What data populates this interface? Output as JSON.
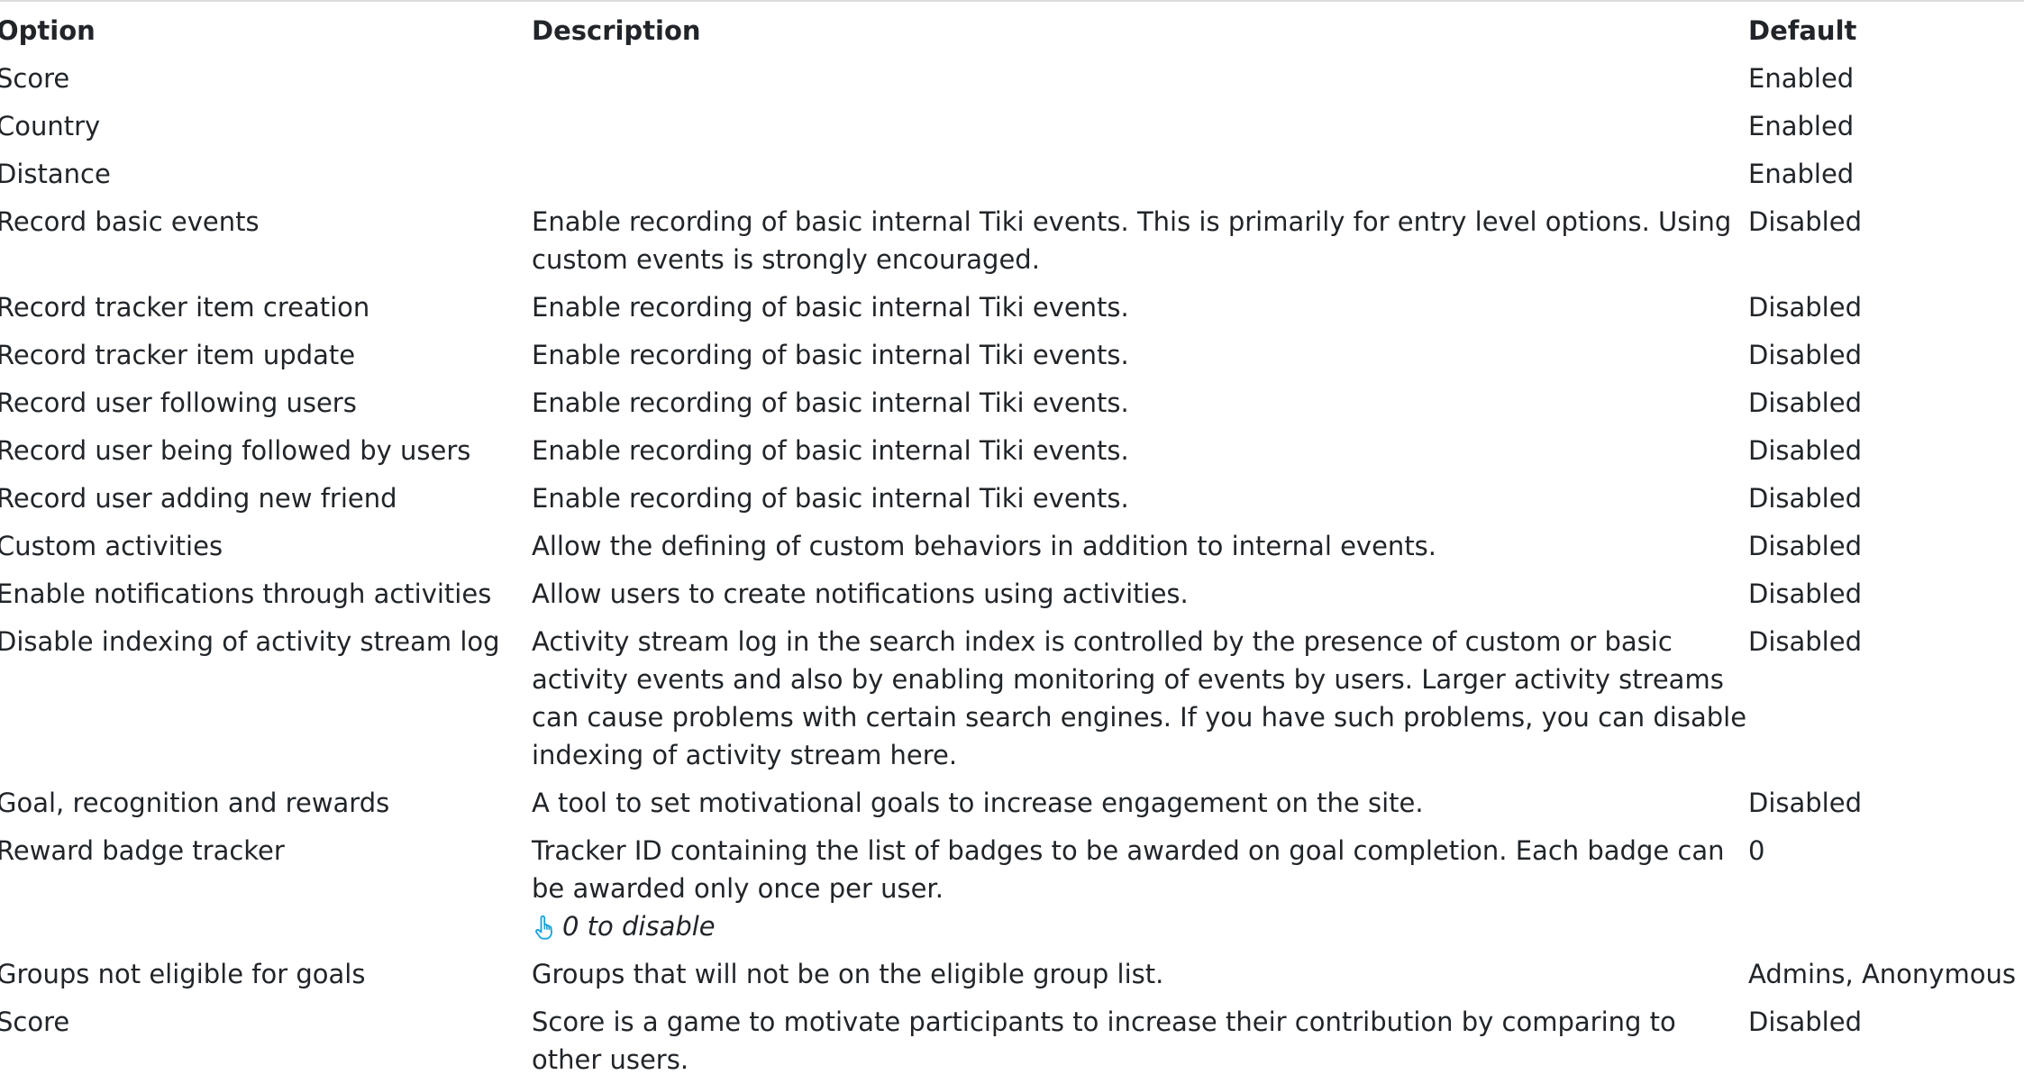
{
  "headers": {
    "option": "Option",
    "description": "Description",
    "default": "Default"
  },
  "rows": [
    {
      "option": "Score",
      "description": "",
      "default": "Enabled"
    },
    {
      "option": "Country",
      "description": "",
      "default": "Enabled"
    },
    {
      "option": "Distance",
      "description": "",
      "default": "Enabled"
    },
    {
      "option": "Record basic events",
      "description": "Enable recording of basic internal Tiki events. This is primarily for entry level options. Using custom events is strongly encouraged.",
      "default": "Disabled"
    },
    {
      "option": "Record tracker item creation",
      "description": "Enable recording of basic internal Tiki events.",
      "default": "Disabled"
    },
    {
      "option": "Record tracker item update",
      "description": "Enable recording of basic internal Tiki events.",
      "default": "Disabled"
    },
    {
      "option": "Record user following users",
      "description": "Enable recording of basic internal Tiki events.",
      "default": "Disabled"
    },
    {
      "option": "Record user being followed by users",
      "description": "Enable recording of basic internal Tiki events.",
      "default": "Disabled"
    },
    {
      "option": "Record user adding new friend",
      "description": "Enable recording of basic internal Tiki events.",
      "default": "Disabled"
    },
    {
      "option": "Custom activities",
      "description": "Allow the defining of custom behaviors in addition to internal events.",
      "default": "Disabled"
    },
    {
      "option": "Enable notifications through activities",
      "description": "Allow users to create notifications using activities.",
      "default": "Disabled"
    },
    {
      "option": "Disable indexing of activity stream log",
      "description": "Activity stream log in the search index is controlled by the presence of custom or basic activity events and also by enabling monitoring of events by users. Larger activity streams can cause problems with certain search engines. If you have such problems, you can disable indexing of activity stream here.",
      "default": "Disabled"
    },
    {
      "option": "Goal, recognition and rewards",
      "description": "A tool to set motivational goals to increase engagement on the site.",
      "default": "Disabled"
    },
    {
      "option": "Reward badge tracker",
      "description": "Tracker ID containing the list of badges to be awarded on goal completion. Each badge can be awarded only once per user.",
      "hint": "0 to disable",
      "default": "0"
    },
    {
      "option": "Groups not eligible for goals",
      "description": "Groups that will not be on the eligible group list.",
      "default": "Admins, Anonymous"
    },
    {
      "option": "Score",
      "description": "Score is a game to motivate participants to increase their contribution by comparing to other users.",
      "default": "Disabled"
    }
  ],
  "icons": {
    "hint_icon": "pointing-hand-icon",
    "hint_icon_color": "#1aa3d9"
  }
}
